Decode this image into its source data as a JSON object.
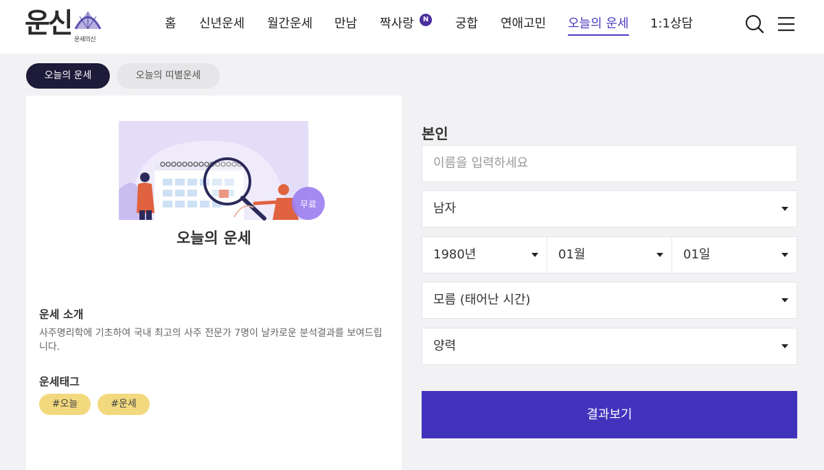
{
  "logo": {
    "main": "운신",
    "sub": "운세의신"
  },
  "nav": {
    "items": [
      "홈",
      "신년운세",
      "월간운세",
      "만남",
      "짝사랑",
      "궁합",
      "연애고민",
      "오늘의 운세",
      "1:1상담"
    ],
    "badge": "N",
    "active": "오늘의 운세"
  },
  "header_icons": [
    "search-icon",
    "menu-icon"
  ],
  "tabs": [
    "오늘의 운세",
    "오늘의 띠별운세"
  ],
  "card": {
    "badge": "무료",
    "title": "오늘의 운세",
    "intro_label": "운세 소개",
    "intro_text": "사주명리학에 기초하여 국내 최고의 사주 전문가 7명이 날카로운 분석결과를 보여드립니다.",
    "tags_label": "운세태그",
    "tags": [
      "#오늘",
      "#운세"
    ]
  },
  "form": {
    "heading": "본인",
    "name_placeholder": "이름을 입력하세요",
    "gender": "남자",
    "year": "1980년",
    "month": "01월",
    "day": "01일",
    "birth_time": "모름 (태어난 시간)",
    "calendar": "양력",
    "submit": "결과보기"
  },
  "colors": {
    "accent": "#4233bd",
    "nav_active": "#4a3bbf",
    "tab_active_bg": "#1e1a3a",
    "tag_bg": "#f3d97e",
    "badge_bg": "#9b7ef0"
  }
}
